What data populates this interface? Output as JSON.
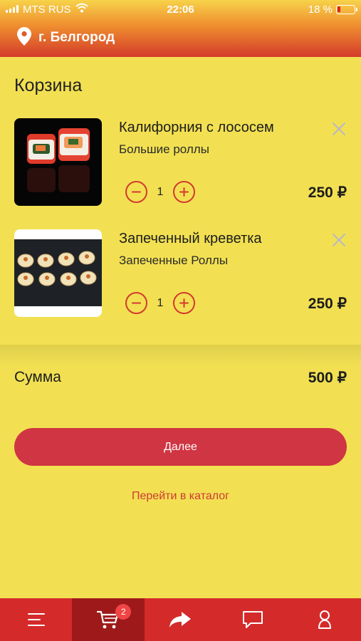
{
  "status_bar": {
    "carrier": "MTS RUS",
    "time": "22:06",
    "battery": "18 %",
    "battery_level": 0.18
  },
  "header": {
    "city": "г. Белгород"
  },
  "cart": {
    "title": "Корзина",
    "items": [
      {
        "name": "Калифорния с лососем",
        "category": "Большие роллы",
        "quantity": "1",
        "price": "250 ₽"
      },
      {
        "name": "Запеченный креветка",
        "category": "Запеченные Роллы",
        "quantity": "1",
        "price": "250 ₽"
      }
    ],
    "sum_label": "Сумма",
    "sum_value": "500 ₽",
    "next_label": "Далее",
    "catalog_link": "Перейти в каталог"
  },
  "tabbar": {
    "cart_badge": "2",
    "tabs": [
      {
        "icon": "menu-icon",
        "active": false
      },
      {
        "icon": "cart-icon",
        "active": true
      },
      {
        "icon": "share-icon",
        "active": false
      },
      {
        "icon": "chat-icon",
        "active": false
      },
      {
        "icon": "profile-icon",
        "active": false
      }
    ]
  },
  "colors": {
    "background": "#f2e052",
    "accent": "#d42a2a",
    "button": "#cf3542"
  }
}
